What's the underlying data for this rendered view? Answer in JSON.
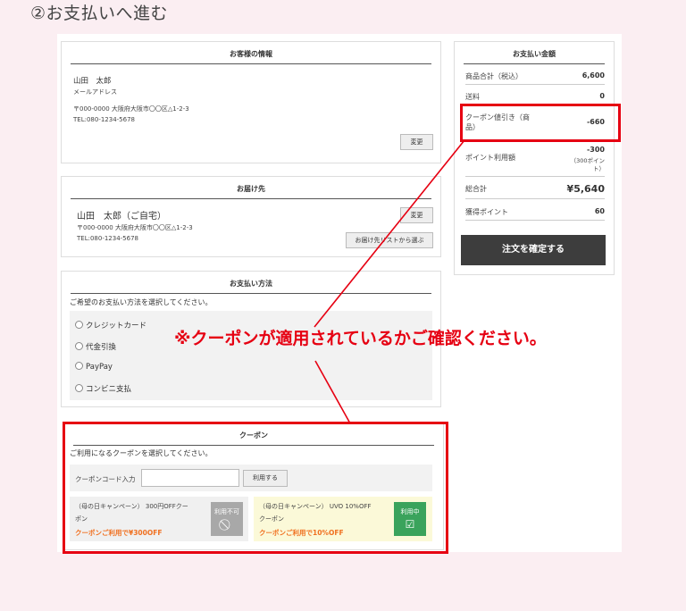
{
  "step_title": "②お支払いへ進む",
  "customer": {
    "heading": "お客様の情報",
    "name": "山田　太郎",
    "email_label": "メールアドレス",
    "address": "〒000-0000 大阪府大阪市〇〇区△1-2-3",
    "tel": "TEL:080-1234-5678",
    "change_label": "変更"
  },
  "delivery": {
    "heading": "お届け先",
    "name": "山田　太郎（ご自宅）",
    "address": "〒000-0000 大阪府大阪市〇〇区△1-2-3",
    "tel": "TEL:080-1234-5678",
    "change_label": "変更",
    "select_from_list_label": "お届け先リストから選ぶ"
  },
  "payment": {
    "heading": "お支払い方法",
    "instruction": "ご希望のお支払い方法を選択してください。",
    "options": [
      "クレジットカード",
      "代金引換",
      "PayPay",
      "コンビニ支払"
    ]
  },
  "notice": "※クーポンが適用されているかご確認ください。",
  "coupon": {
    "heading": "クーポン",
    "instruction": "ご利用になるクーポンを選択してください。",
    "code_label": "クーポンコード入力",
    "code_value": "",
    "apply_label": "利用する",
    "cards": [
      {
        "title_line1": "（母の日キャンペーン） 300円OFFクー",
        "title_line2": "ポン",
        "condition": "クーポンご利用で¥300OFF",
        "badge": "利用不可",
        "badge_icon": "⃠",
        "badge_color": "#a8a8a8"
      },
      {
        "title_line1": "（母の日キャンペーン） UVO 10%OFF",
        "title_line2": "クーポン",
        "condition": "クーポンご利用で10%OFF",
        "badge": "利用中",
        "badge_icon": "☑",
        "badge_color": "#3aa35c"
      }
    ]
  },
  "summary": {
    "heading": "お支払い金額",
    "rows": [
      {
        "label": "商品合計（税込）",
        "value": "6,600"
      },
      {
        "label": "送料",
        "value": "0"
      },
      {
        "label_line1": "クーポン値引き（商",
        "label_line2": "品）",
        "value": "-660"
      },
      {
        "label": "ポイント利用額",
        "value": "-300",
        "note_line1": "（300ポイン",
        "note_line2": "ト）"
      },
      {
        "label": "総合計",
        "value": "¥5,640"
      },
      {
        "label": "獲得ポイント",
        "value": "60"
      }
    ],
    "confirm_label": "注文を確定する"
  },
  "colors": {
    "page_bg": "#fbeef2",
    "highlight_red": "#e60012",
    "coupon_orange": "#f07020",
    "confirm_button": "#3d3d3d"
  }
}
